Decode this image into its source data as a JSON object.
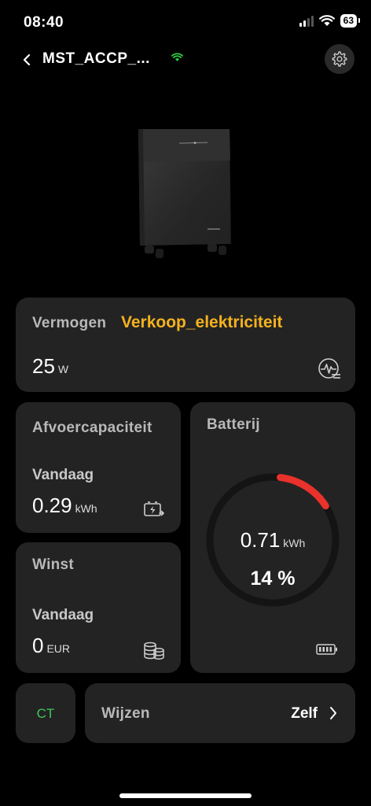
{
  "status": {
    "time": "08:40",
    "battery_level": "63"
  },
  "header": {
    "title": "MST_ACCP_..."
  },
  "power_card": {
    "label": "Vermogen",
    "mode": "Verkoop_elektriciteit",
    "value": "25",
    "unit": "W"
  },
  "discharge_card": {
    "label": "Afvoercapaciteit",
    "period": "Vandaag",
    "value": "0.29",
    "unit": "kWh"
  },
  "profit_card": {
    "label": "Winst",
    "period": "Vandaag",
    "value": "0",
    "unit": "EUR"
  },
  "battery_card": {
    "label": "Batterij",
    "energy": "0.71",
    "unit": "kWh",
    "percent_text": "14 %",
    "percent": 14
  },
  "ct_button": {
    "label": "CT"
  },
  "mode_row": {
    "label": "Wijzen",
    "value": "Zelf"
  },
  "colors": {
    "accent_yellow": "#f5b21e",
    "ct_green": "#3ec65a",
    "wifi_green": "#2ecc40",
    "ring_red": "#e8322b",
    "card_bg": "#232323"
  },
  "icons": {
    "back": "chevron-left-icon",
    "wifi": "wifi-icon",
    "settings": "gear-icon",
    "power": "pulse-icon",
    "discharge": "battery-charge-icon",
    "profit": "coins-icon",
    "battery": "battery-icon",
    "next": "chevron-right-icon"
  }
}
